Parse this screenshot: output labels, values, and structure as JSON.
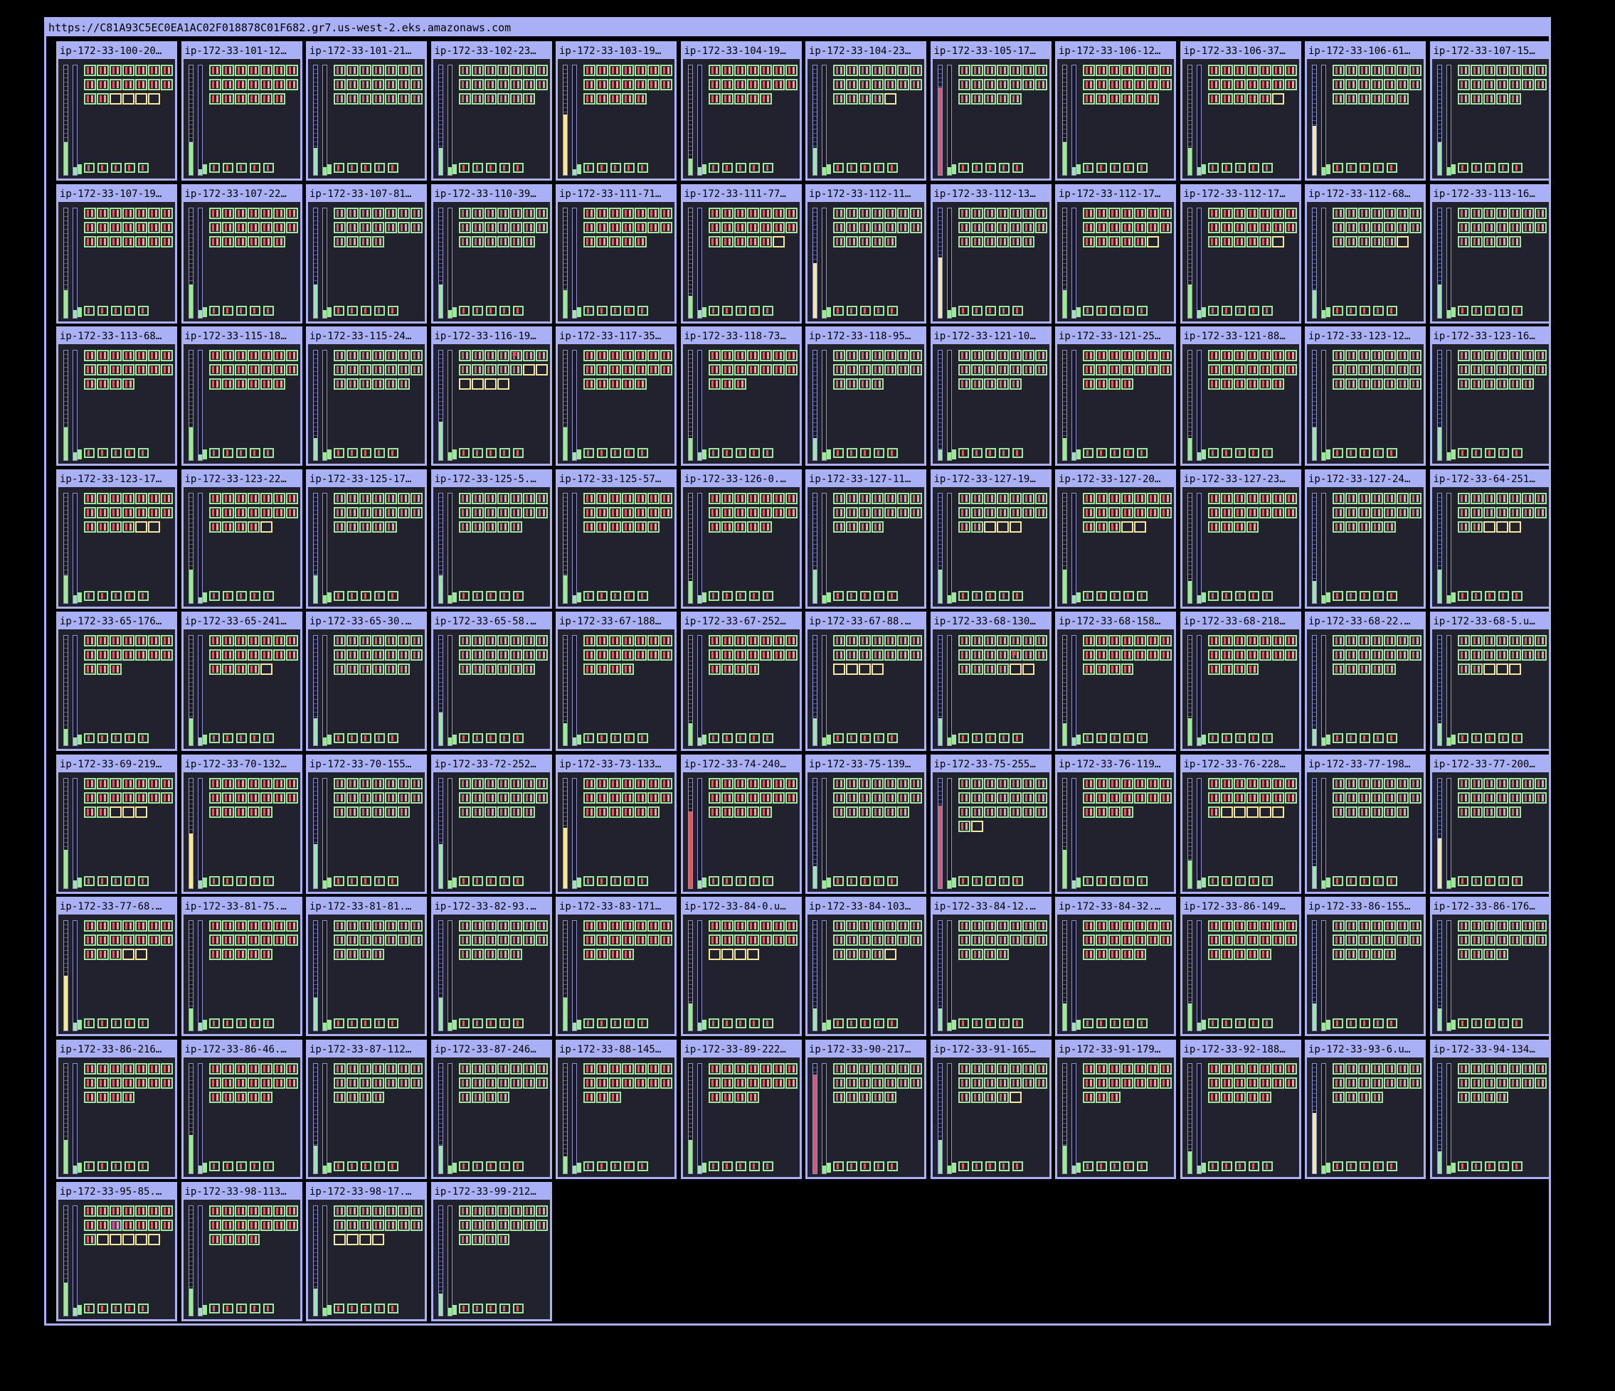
{
  "cluster": {
    "url": "https://C81A93C5EC0EA1AC02F018878C01F682.gr7.us-west-2.eks.amazonaws.com"
  },
  "colors": {
    "frame": "#a9b0f5",
    "node_bg": "#22222f",
    "pod_running": "#9ee89b",
    "pod_pending": "#f5e89a",
    "pod_error": "#ff4a5a",
    "gauge_green": "#9ee89b",
    "gauge_yellow": "#f5e89a",
    "gauge_red": "#e0595f"
  },
  "nodes": [
    {
      "name": "ip-172-33-100-20…",
      "cpu": 0.3,
      "mem": 0.07,
      "pods": 20,
      "pending": 4,
      "error": null,
      "terminating": null
    },
    {
      "name": "ip-172-33-101-12…",
      "cpu": 0.3,
      "mem": 0.05,
      "pods": 20,
      "pending": 0,
      "error": null,
      "terminating": null
    },
    {
      "name": "ip-172-33-101-21…",
      "cpu": 0.25,
      "mem": 0.07,
      "pods": 21,
      "pending": 0,
      "error": null,
      "terminating": null
    },
    {
      "name": "ip-172-33-102-23…",
      "cpu": 0.25,
      "mem": 0.07,
      "pods": 20,
      "pending": 0,
      "error": null,
      "terminating": null
    },
    {
      "name": "ip-172-33-103-19…",
      "cpu": 0.55,
      "mem": 0.05,
      "pods": 19,
      "pending": 0,
      "error": null,
      "terminating": null
    },
    {
      "name": "ip-172-33-104-19…",
      "cpu": 0.15,
      "mem": 0.07,
      "pods": 19,
      "pending": 0,
      "error": null,
      "terminating": null
    },
    {
      "name": "ip-172-33-104-23…",
      "cpu": 0.25,
      "mem": 0.07,
      "pods": 19,
      "pending": 1,
      "error": null,
      "terminating": null
    },
    {
      "name": "ip-172-33-105-17…",
      "cpu": 0.8,
      "mem": 0.07,
      "pods": 19,
      "pending": 0,
      "error": null,
      "terminating": null
    },
    {
      "name": "ip-172-33-106-12…",
      "cpu": 0.3,
      "mem": 0.07,
      "pods": 20,
      "pending": 0,
      "error": null,
      "terminating": null
    },
    {
      "name": "ip-172-33-106-37…",
      "cpu": 0.25,
      "mem": 0.07,
      "pods": 20,
      "pending": 1,
      "error": null,
      "terminating": null
    },
    {
      "name": "ip-172-33-106-61…",
      "cpu": 0.45,
      "mem": 0.07,
      "pods": 20,
      "pending": 0,
      "error": null,
      "terminating": null
    },
    {
      "name": "ip-172-33-107-15…",
      "cpu": 0.3,
      "mem": 0.07,
      "pods": 19,
      "pending": 0,
      "error": null,
      "terminating": null
    },
    {
      "name": "ip-172-33-107-19…",
      "cpu": 0.25,
      "mem": 0.07,
      "pods": 21,
      "pending": 0,
      "error": null,
      "terminating": null
    },
    {
      "name": "ip-172-33-107-22…",
      "cpu": 0.3,
      "mem": 0.07,
      "pods": 20,
      "pending": 0,
      "error": null,
      "terminating": null
    },
    {
      "name": "ip-172-33-107-81…",
      "cpu": 0.3,
      "mem": 0.07,
      "pods": 18,
      "pending": 0,
      "error": null,
      "terminating": null
    },
    {
      "name": "ip-172-33-110-39…",
      "cpu": 0.3,
      "mem": 0.07,
      "pods": 20,
      "pending": 0,
      "error": null,
      "terminating": null
    },
    {
      "name": "ip-172-33-111-71…",
      "cpu": 0.25,
      "mem": 0.07,
      "pods": 19,
      "pending": 0,
      "error": null,
      "terminating": null
    },
    {
      "name": "ip-172-33-111-77…",
      "cpu": 0.2,
      "mem": 0.07,
      "pods": 20,
      "pending": 1,
      "error": null,
      "terminating": null
    },
    {
      "name": "ip-172-33-112-11…",
      "cpu": 0.5,
      "mem": 0.07,
      "pods": 19,
      "pending": 0,
      "error": null,
      "terminating": null
    },
    {
      "name": "ip-172-33-112-13…",
      "cpu": 0.55,
      "mem": 0.07,
      "pods": 20,
      "pending": 0,
      "error": null,
      "terminating": null
    },
    {
      "name": "ip-172-33-112-17…",
      "cpu": 0.25,
      "mem": 0.07,
      "pods": 20,
      "pending": 1,
      "error": null,
      "terminating": null
    },
    {
      "name": "ip-172-33-112-17…",
      "cpu": 0.3,
      "mem": 0.07,
      "pods": 20,
      "pending": 1,
      "error": null,
      "terminating": null
    },
    {
      "name": "ip-172-33-112-68…",
      "cpu": 0.25,
      "mem": 0.07,
      "pods": 20,
      "pending": 1,
      "error": null,
      "terminating": null
    },
    {
      "name": "ip-172-33-113-16…",
      "cpu": 0.3,
      "mem": 0.07,
      "pods": 19,
      "pending": 0,
      "error": null,
      "terminating": null
    },
    {
      "name": "ip-172-33-113-68…",
      "cpu": 0.3,
      "mem": 0.07,
      "pods": 18,
      "pending": 0,
      "error": null,
      "terminating": null
    },
    {
      "name": "ip-172-33-115-18…",
      "cpu": 0.3,
      "mem": 0.05,
      "pods": 20,
      "pending": 0,
      "error": null,
      "terminating": null
    },
    {
      "name": "ip-172-33-115-24…",
      "cpu": 0.2,
      "mem": 0.07,
      "pods": 20,
      "pending": 0,
      "error": null,
      "terminating": null
    },
    {
      "name": "ip-172-33-116-19…",
      "cpu": 0.35,
      "mem": 0.07,
      "pods": 18,
      "pending": 6,
      "error": 4,
      "terminating": null
    },
    {
      "name": "ip-172-33-117-35…",
      "cpu": 0.3,
      "mem": 0.07,
      "pods": 19,
      "pending": 0,
      "error": null,
      "terminating": null
    },
    {
      "name": "ip-172-33-118-73…",
      "cpu": 0.2,
      "mem": 0.07,
      "pods": 17,
      "pending": 0,
      "error": null,
      "terminating": null
    },
    {
      "name": "ip-172-33-118-95…",
      "cpu": 0.2,
      "mem": 0.07,
      "pods": 18,
      "pending": 0,
      "error": null,
      "terminating": null
    },
    {
      "name": "ip-172-33-121-10…",
      "cpu": 0.1,
      "mem": 0.07,
      "pods": 19,
      "pending": 0,
      "error": null,
      "terminating": null
    },
    {
      "name": "ip-172-33-121-25…",
      "cpu": 0.2,
      "mem": 0.07,
      "pods": 18,
      "pending": 0,
      "error": null,
      "terminating": null
    },
    {
      "name": "ip-172-33-121-88…",
      "cpu": 0.2,
      "mem": 0.07,
      "pods": 20,
      "pending": 0,
      "error": null,
      "terminating": null
    },
    {
      "name": "ip-172-33-123-12…",
      "cpu": 0.3,
      "mem": 0.07,
      "pods": 21,
      "pending": 0,
      "error": null,
      "terminating": null
    },
    {
      "name": "ip-172-33-123-16…",
      "cpu": 0.3,
      "mem": 0.07,
      "pods": 20,
      "pending": 0,
      "error": null,
      "terminating": null
    },
    {
      "name": "ip-172-33-123-17…",
      "cpu": 0.25,
      "mem": 0.07,
      "pods": 20,
      "pending": 2,
      "error": null,
      "terminating": null
    },
    {
      "name": "ip-172-33-123-22…",
      "cpu": 0.3,
      "mem": 0.05,
      "pods": 19,
      "pending": 1,
      "error": null,
      "terminating": null
    },
    {
      "name": "ip-172-33-125-17…",
      "cpu": 0.25,
      "mem": 0.07,
      "pods": 19,
      "pending": 0,
      "error": null,
      "terminating": null
    },
    {
      "name": "ip-172-33-125-5.…",
      "cpu": 0.25,
      "mem": 0.07,
      "pods": 19,
      "pending": 0,
      "error": null,
      "terminating": null
    },
    {
      "name": "ip-172-33-125-57…",
      "cpu": 0.25,
      "mem": 0.07,
      "pods": 20,
      "pending": 0,
      "error": null,
      "terminating": null
    },
    {
      "name": "ip-172-33-126-0.…",
      "cpu": 0.2,
      "mem": 0.07,
      "pods": 19,
      "pending": 0,
      "error": null,
      "terminating": null
    },
    {
      "name": "ip-172-33-127-11…",
      "cpu": 0.3,
      "mem": 0.07,
      "pods": 18,
      "pending": 0,
      "error": null,
      "terminating": null
    },
    {
      "name": "ip-172-33-127-19…",
      "cpu": 0.3,
      "mem": 0.07,
      "pods": 19,
      "pending": 3,
      "error": null,
      "terminating": null
    },
    {
      "name": "ip-172-33-127-20…",
      "cpu": 0.3,
      "mem": 0.07,
      "pods": 19,
      "pending": 2,
      "error": null,
      "terminating": null
    },
    {
      "name": "ip-172-33-127-23…",
      "cpu": 0.2,
      "mem": 0.07,
      "pods": 18,
      "pending": 0,
      "error": null,
      "terminating": null
    },
    {
      "name": "ip-172-33-127-24…",
      "cpu": 0.2,
      "mem": 0.07,
      "pods": 19,
      "pending": 0,
      "error": null,
      "terminating": null
    },
    {
      "name": "ip-172-33-64-251…",
      "cpu": 0.3,
      "mem": 0.07,
      "pods": 19,
      "pending": 3,
      "error": null,
      "terminating": null
    },
    {
      "name": "ip-172-33-65-176…",
      "cpu": 0.15,
      "mem": 0.07,
      "pods": 17,
      "pending": 0,
      "error": null,
      "terminating": null
    },
    {
      "name": "ip-172-33-65-241…",
      "cpu": 0.25,
      "mem": 0.07,
      "pods": 19,
      "pending": 1,
      "error": null,
      "terminating": null
    },
    {
      "name": "ip-172-33-65-30.…",
      "cpu": 0.25,
      "mem": 0.07,
      "pods": 20,
      "pending": 0,
      "error": null,
      "terminating": null
    },
    {
      "name": "ip-172-33-65-58.…",
      "cpu": 0.3,
      "mem": 0.07,
      "pods": 20,
      "pending": 0,
      "error": null,
      "terminating": null
    },
    {
      "name": "ip-172-33-67-188…",
      "cpu": 0.2,
      "mem": 0.07,
      "pods": 18,
      "pending": 0,
      "error": null,
      "terminating": null
    },
    {
      "name": "ip-172-33-67-252…",
      "cpu": 0.2,
      "mem": 0.07,
      "pods": 18,
      "pending": 0,
      "error": null,
      "terminating": null
    },
    {
      "name": "ip-172-33-67-88.…",
      "cpu": 0.25,
      "mem": 0.07,
      "pods": 18,
      "pending": 4,
      "error": null,
      "terminating": null
    },
    {
      "name": "ip-172-33-68-130…",
      "cpu": 0.25,
      "mem": 0.07,
      "pods": 20,
      "pending": 2,
      "error": 11,
      "terminating": null
    },
    {
      "name": "ip-172-33-68-158…",
      "cpu": 0.2,
      "mem": 0.07,
      "pods": 18,
      "pending": 0,
      "error": null,
      "terminating": null
    },
    {
      "name": "ip-172-33-68-218…",
      "cpu": 0.25,
      "mem": 0.07,
      "pods": 18,
      "pending": 0,
      "error": null,
      "terminating": null
    },
    {
      "name": "ip-172-33-68-22.…",
      "cpu": 0.15,
      "mem": 0.07,
      "pods": 19,
      "pending": 0,
      "error": null,
      "terminating": null
    },
    {
      "name": "ip-172-33-68-5.u…",
      "cpu": 0.2,
      "mem": 0.07,
      "pods": 19,
      "pending": 3,
      "error": null,
      "terminating": null
    },
    {
      "name": "ip-172-33-69-219…",
      "cpu": 0.35,
      "mem": 0.07,
      "pods": 19,
      "pending": 3,
      "error": null,
      "terminating": null
    },
    {
      "name": "ip-172-33-70-132…",
      "cpu": 0.5,
      "mem": 0.07,
      "pods": 19,
      "pending": 0,
      "error": null,
      "terminating": null
    },
    {
      "name": "ip-172-33-70-155…",
      "cpu": 0.4,
      "mem": 0.07,
      "pods": 20,
      "pending": 0,
      "error": null,
      "terminating": null
    },
    {
      "name": "ip-172-33-72-252…",
      "cpu": 0.4,
      "mem": 0.07,
      "pods": 20,
      "pending": 0,
      "error": null,
      "terminating": null
    },
    {
      "name": "ip-172-33-73-133…",
      "cpu": 0.55,
      "mem": 0.07,
      "pods": 20,
      "pending": 0,
      "error": null,
      "terminating": null
    },
    {
      "name": "ip-172-33-74-240…",
      "cpu": 0.7,
      "mem": 0.07,
      "pods": 19,
      "pending": 0,
      "error": null,
      "terminating": null
    },
    {
      "name": "ip-172-33-75-139…",
      "cpu": 0.2,
      "mem": 0.07,
      "pods": 20,
      "pending": 0,
      "error": null,
      "terminating": null
    },
    {
      "name": "ip-172-33-75-255…",
      "cpu": 0.75,
      "mem": 0.07,
      "pods": 23,
      "pending": 1,
      "error": null,
      "terminating": null
    },
    {
      "name": "ip-172-33-76-119…",
      "cpu": 0.35,
      "mem": 0.07,
      "pods": 18,
      "pending": 0,
      "error": null,
      "terminating": null
    },
    {
      "name": "ip-172-33-76-228…",
      "cpu": 0.25,
      "mem": 0.07,
      "pods": 20,
      "pending": 5,
      "error": null,
      "terminating": null
    },
    {
      "name": "ip-172-33-77-198…",
      "cpu": 0.2,
      "mem": 0.07,
      "pods": 20,
      "pending": 0,
      "error": null,
      "terminating": null
    },
    {
      "name": "ip-172-33-77-200…",
      "cpu": 0.45,
      "mem": 0.07,
      "pods": 19,
      "pending": 0,
      "error": null,
      "terminating": null
    },
    {
      "name": "ip-172-33-77-68.…",
      "cpu": 0.5,
      "mem": 0.07,
      "pods": 19,
      "pending": 2,
      "error": null,
      "terminating": null
    },
    {
      "name": "ip-172-33-81-75.…",
      "cpu": 0.2,
      "mem": 0.07,
      "pods": 19,
      "pending": 0,
      "error": null,
      "terminating": null
    },
    {
      "name": "ip-172-33-81-81.…",
      "cpu": 0.3,
      "mem": 0.07,
      "pods": 18,
      "pending": 0,
      "error": null,
      "terminating": null
    },
    {
      "name": "ip-172-33-82-93.…",
      "cpu": 0.3,
      "mem": 0.07,
      "pods": 19,
      "pending": 0,
      "error": null,
      "terminating": null
    },
    {
      "name": "ip-172-33-83-171…",
      "cpu": 0.3,
      "mem": 0.07,
      "pods": 18,
      "pending": 0,
      "error": null,
      "terminating": null
    },
    {
      "name": "ip-172-33-84-0.u…",
      "cpu": 0.25,
      "mem": 0.07,
      "pods": 18,
      "pending": 4,
      "error": null,
      "terminating": null
    },
    {
      "name": "ip-172-33-84-103…",
      "cpu": 0.2,
      "mem": 0.07,
      "pods": 19,
      "pending": 1,
      "error": null,
      "terminating": null
    },
    {
      "name": "ip-172-33-84-12.…",
      "cpu": 0.2,
      "mem": 0.07,
      "pods": 18,
      "pending": 0,
      "error": null,
      "terminating": null
    },
    {
      "name": "ip-172-33-84-32.…",
      "cpu": 0.25,
      "mem": 0.07,
      "pods": 19,
      "pending": 0,
      "error": null,
      "terminating": null
    },
    {
      "name": "ip-172-33-86-149…",
      "cpu": 0.25,
      "mem": 0.07,
      "pods": 19,
      "pending": 0,
      "error": null,
      "terminating": null
    },
    {
      "name": "ip-172-33-86-155…",
      "cpu": 0.25,
      "mem": 0.07,
      "pods": 19,
      "pending": 0,
      "error": null,
      "terminating": null
    },
    {
      "name": "ip-172-33-86-176…",
      "cpu": 0.2,
      "mem": 0.07,
      "pods": 18,
      "pending": 0,
      "error": null,
      "terminating": null
    },
    {
      "name": "ip-172-33-86-216…",
      "cpu": 0.3,
      "mem": 0.07,
      "pods": 18,
      "pending": 0,
      "error": null,
      "terminating": null
    },
    {
      "name": "ip-172-33-86-46.…",
      "cpu": 0.35,
      "mem": 0.07,
      "pods": 19,
      "pending": 0,
      "error": null,
      "terminating": null
    },
    {
      "name": "ip-172-33-87-112…",
      "cpu": 0.25,
      "mem": 0.07,
      "pods": 18,
      "pending": 0,
      "error": null,
      "terminating": null
    },
    {
      "name": "ip-172-33-87-246…",
      "cpu": 0.25,
      "mem": 0.07,
      "pods": 18,
      "pending": 0,
      "error": null,
      "terminating": null
    },
    {
      "name": "ip-172-33-88-145…",
      "cpu": 0.15,
      "mem": 0.07,
      "pods": 17,
      "pending": 0,
      "error": null,
      "terminating": null
    },
    {
      "name": "ip-172-33-89-222…",
      "cpu": 0.3,
      "mem": 0.07,
      "pods": 18,
      "pending": 0,
      "error": null,
      "terminating": null
    },
    {
      "name": "ip-172-33-90-217…",
      "cpu": 0.9,
      "mem": 0.07,
      "pods": 19,
      "pending": 0,
      "error": null,
      "terminating": null
    },
    {
      "name": "ip-172-33-91-165…",
      "cpu": 0.3,
      "mem": 0.07,
      "pods": 19,
      "pending": 1,
      "error": null,
      "terminating": null
    },
    {
      "name": "ip-172-33-91-179…",
      "cpu": 0.25,
      "mem": 0.07,
      "pods": 17,
      "pending": 0,
      "error": null,
      "terminating": null
    },
    {
      "name": "ip-172-33-92-188…",
      "cpu": 0.2,
      "mem": 0.07,
      "pods": 19,
      "pending": 0,
      "error": null,
      "terminating": null
    },
    {
      "name": "ip-172-33-93-6.u…",
      "cpu": 0.55,
      "mem": 0.07,
      "pods": 18,
      "pending": 0,
      "error": null,
      "terminating": null
    },
    {
      "name": "ip-172-33-94-134…",
      "cpu": 0.2,
      "mem": 0.07,
      "pods": 18,
      "pending": 0,
      "error": null,
      "terminating": null
    },
    {
      "name": "ip-172-33-95-85.…",
      "cpu": 0.3,
      "mem": 0.07,
      "pods": 20,
      "pending": 5,
      "error": null,
      "terminating": 9
    },
    {
      "name": "ip-172-33-98-113…",
      "cpu": 0.25,
      "mem": 0.07,
      "pods": 18,
      "pending": 0,
      "error": null,
      "terminating": null
    },
    {
      "name": "ip-172-33-98-17.…",
      "cpu": 0.25,
      "mem": 0.07,
      "pods": 18,
      "pending": 4,
      "error": null,
      "terminating": null
    },
    {
      "name": "ip-172-33-99-212…",
      "cpu": 0.2,
      "mem": 0.07,
      "pods": 18,
      "pending": 0,
      "error": null,
      "terminating": null
    }
  ]
}
